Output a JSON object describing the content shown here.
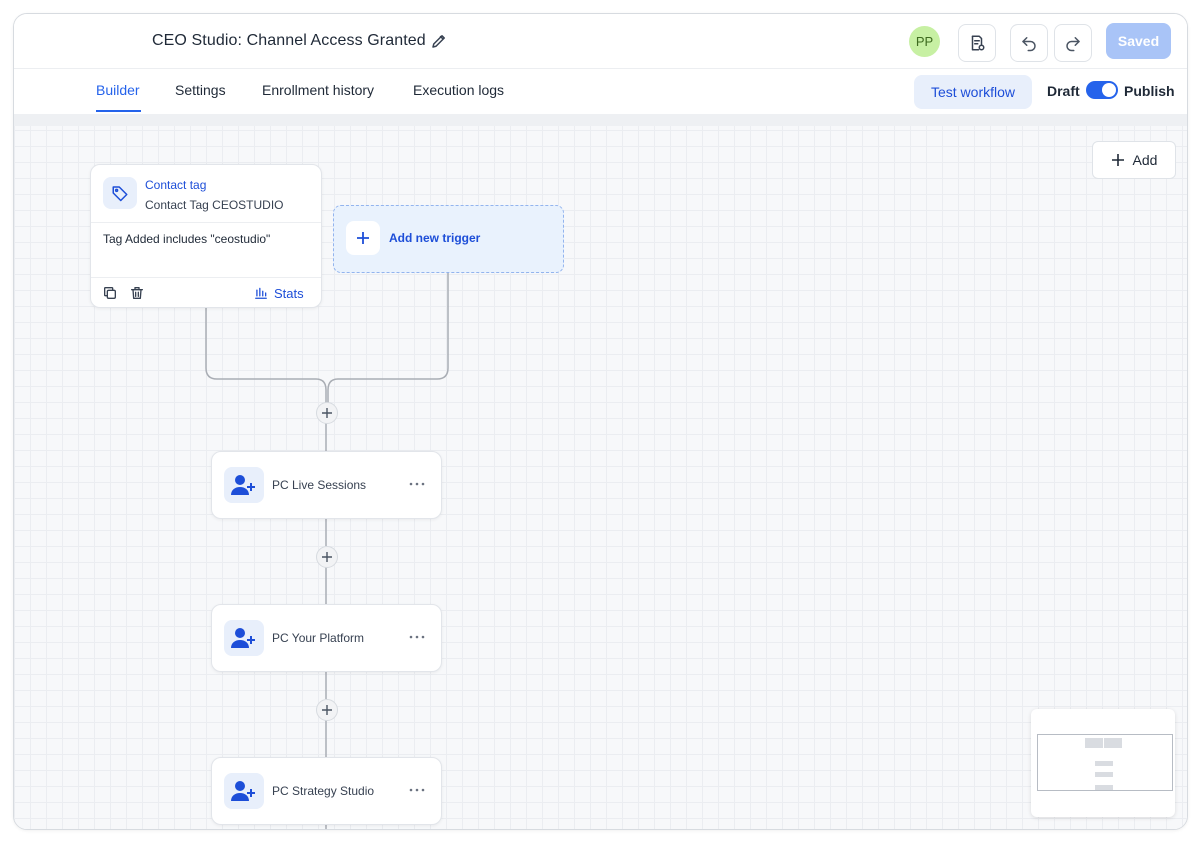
{
  "header": {
    "title": "CEO Studio: Channel Access Granted",
    "avatar_initials": "PP",
    "avatar_color": "#c7f0a3",
    "saved_label": "Saved"
  },
  "tabs": [
    {
      "label": "Builder",
      "active": true
    },
    {
      "label": "Settings",
      "active": false
    },
    {
      "label": "Enrollment history",
      "active": false
    },
    {
      "label": "Execution logs",
      "active": false
    }
  ],
  "toolbar": {
    "test_workflow_label": "Test workflow",
    "draft_label": "Draft",
    "publish_label": "Publish",
    "publish_enabled": true
  },
  "canvas": {
    "add_button_label": "Add",
    "trigger": {
      "type": "Contact tag",
      "name": "Contact Tag CEOSTUDIO",
      "condition": "Tag Added includes \"ceostudio\"",
      "stats_label": "Stats"
    },
    "add_trigger_label": "Add new trigger",
    "actions": [
      {
        "label": "PC Live Sessions"
      },
      {
        "label": "PC Your Platform"
      },
      {
        "label": "PC Strategy Studio"
      }
    ]
  },
  "colors": {
    "accent": "#2563eb",
    "saved_button": "#a9c4f7",
    "canvas_bg": "#f7f8fa"
  }
}
